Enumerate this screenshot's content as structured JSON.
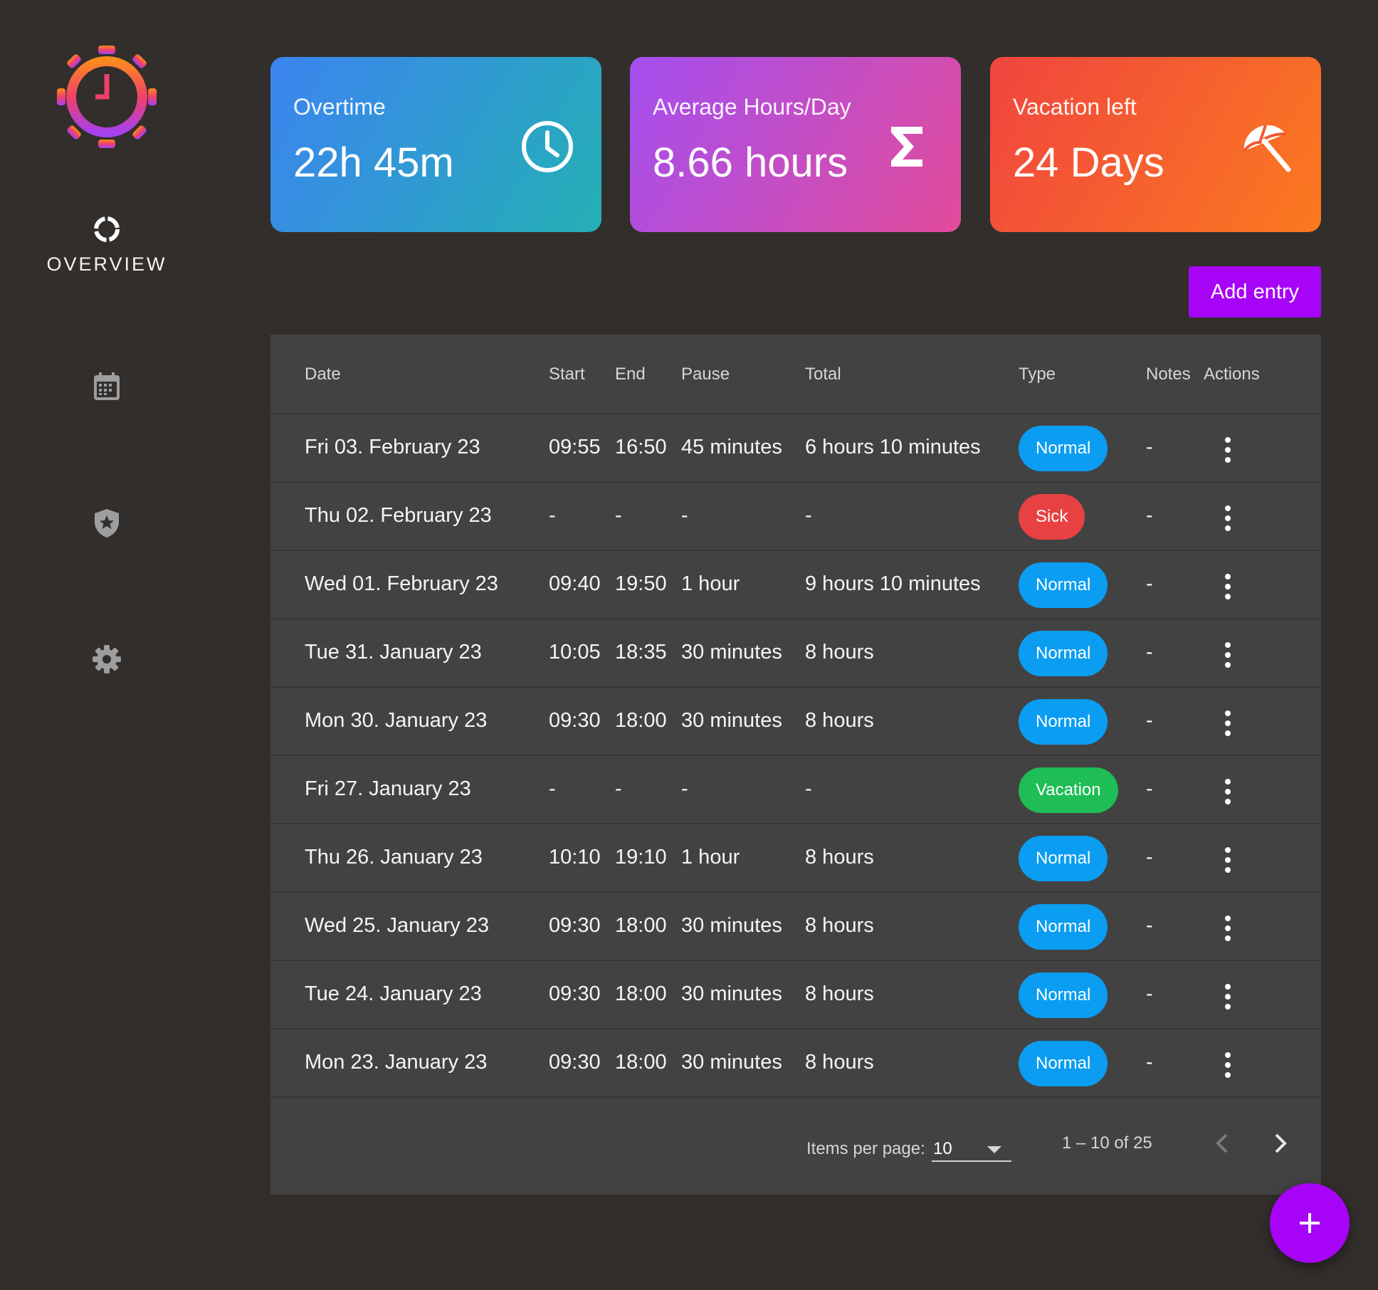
{
  "sidebar": {
    "logo_icon": "clock-gear-logo-icon",
    "items": [
      {
        "label": "OVERVIEW",
        "icon": "overview-ring-icon",
        "active": true
      },
      {
        "label": "",
        "icon": "calendar-icon",
        "active": false
      },
      {
        "label": "",
        "icon": "shield-star-icon",
        "active": false
      },
      {
        "label": "",
        "icon": "gear-icon",
        "active": false
      }
    ]
  },
  "stats": {
    "overtime": {
      "title": "Overtime",
      "value": "22h 45m",
      "icon": "clock-icon"
    },
    "average": {
      "title": "Average Hours/Day",
      "value": "8.66 hours",
      "icon": "sigma-icon"
    },
    "vacation": {
      "title": "Vacation left",
      "value": "24 Days",
      "icon": "beach-umbrella-icon"
    }
  },
  "toolbar": {
    "add_entry_label": "Add entry"
  },
  "table": {
    "headers": {
      "date": "Date",
      "start": "Start",
      "end": "End",
      "pause": "Pause",
      "total": "Total",
      "type": "Type",
      "notes": "Notes",
      "actions": "Actions"
    },
    "rows": [
      {
        "date": "Fri 03. February 23",
        "start": "09:55",
        "end": "16:50",
        "pause": "45 minutes",
        "total": "6 hours 10 minutes",
        "type": "Normal",
        "notes": "-"
      },
      {
        "date": "Thu 02. February 23",
        "start": "-",
        "end": "-",
        "pause": "-",
        "total": "-",
        "type": "Sick",
        "notes": "-"
      },
      {
        "date": "Wed 01. February 23",
        "start": "09:40",
        "end": "19:50",
        "pause": "1 hour",
        "total": "9 hours 10 minutes",
        "type": "Normal",
        "notes": "-"
      },
      {
        "date": "Tue 31. January 23",
        "start": "10:05",
        "end": "18:35",
        "pause": "30 minutes",
        "total": "8 hours",
        "type": "Normal",
        "notes": "-"
      },
      {
        "date": "Mon 30. January 23",
        "start": "09:30",
        "end": "18:00",
        "pause": "30 minutes",
        "total": "8 hours",
        "type": "Normal",
        "notes": "-"
      },
      {
        "date": "Fri 27. January 23",
        "start": "-",
        "end": "-",
        "pause": "-",
        "total": "-",
        "type": "Vacation",
        "notes": "-"
      },
      {
        "date": "Thu 26. January 23",
        "start": "10:10",
        "end": "19:10",
        "pause": "1 hour",
        "total": "8 hours",
        "type": "Normal",
        "notes": "-"
      },
      {
        "date": "Wed 25. January 23",
        "start": "09:30",
        "end": "18:00",
        "pause": "30 minutes",
        "total": "8 hours",
        "type": "Normal",
        "notes": "-"
      },
      {
        "date": "Tue 24. January 23",
        "start": "09:30",
        "end": "18:00",
        "pause": "30 minutes",
        "total": "8 hours",
        "type": "Normal",
        "notes": "-"
      },
      {
        "date": "Mon 23. January 23",
        "start": "09:30",
        "end": "18:00",
        "pause": "30 minutes",
        "total": "8 hours",
        "type": "Normal",
        "notes": "-"
      }
    ]
  },
  "paginator": {
    "items_per_page_label": "Items per page:",
    "items_per_page_value": "10",
    "range_label": "1 – 10 of 25"
  },
  "fab": {
    "icon": "plus-icon"
  },
  "colors": {
    "background": "#312e2c",
    "table": "#424242",
    "accent": "#a704f7",
    "normal": "#0a9df2",
    "sick": "#e84141",
    "vacation": "#1ebd55"
  }
}
